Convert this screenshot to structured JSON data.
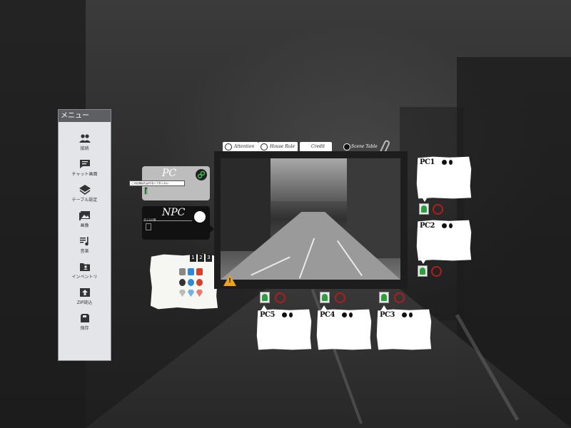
{
  "menu": {
    "title": "メニュー",
    "items": [
      {
        "label": "接続",
        "icon": "people-icon"
      },
      {
        "label": "チャット画面",
        "icon": "chat-icon"
      },
      {
        "label": "テーブル設定",
        "icon": "layers-icon"
      },
      {
        "label": "画像",
        "icon": "image-icon"
      },
      {
        "label": "音楽",
        "icon": "music-icon"
      },
      {
        "label": "インベントリ",
        "icon": "inventory-icon"
      },
      {
        "label": "ZIP読込",
        "icon": "upload-icon"
      },
      {
        "label": "保存",
        "icon": "save-icon"
      }
    ]
  },
  "pc_panel": {
    "title": "PC",
    "bar_text": "この比例はもはやなくておくわい"
  },
  "npc_panel": {
    "title": "NPC",
    "bar_text": "ダイスの値"
  },
  "note": {
    "tickets": [
      "1",
      "2",
      "3"
    ]
  },
  "tabs": [
    {
      "label": "Attention"
    },
    {
      "label": "House Rule"
    },
    {
      "label": "Credit"
    },
    {
      "label": "Scene Table"
    }
  ],
  "cards": [
    {
      "name": "PC1"
    },
    {
      "name": "PC2"
    },
    {
      "name": "PC5"
    },
    {
      "name": "PC4"
    },
    {
      "name": "PC3"
    }
  ],
  "colors": {
    "accent_green": "#2f9d3f",
    "ring_red": "#b01e1e",
    "warning": "#f0a31a",
    "menu_bg": "#e3e5e8",
    "menu_title_bg": "#5d5f62"
  }
}
